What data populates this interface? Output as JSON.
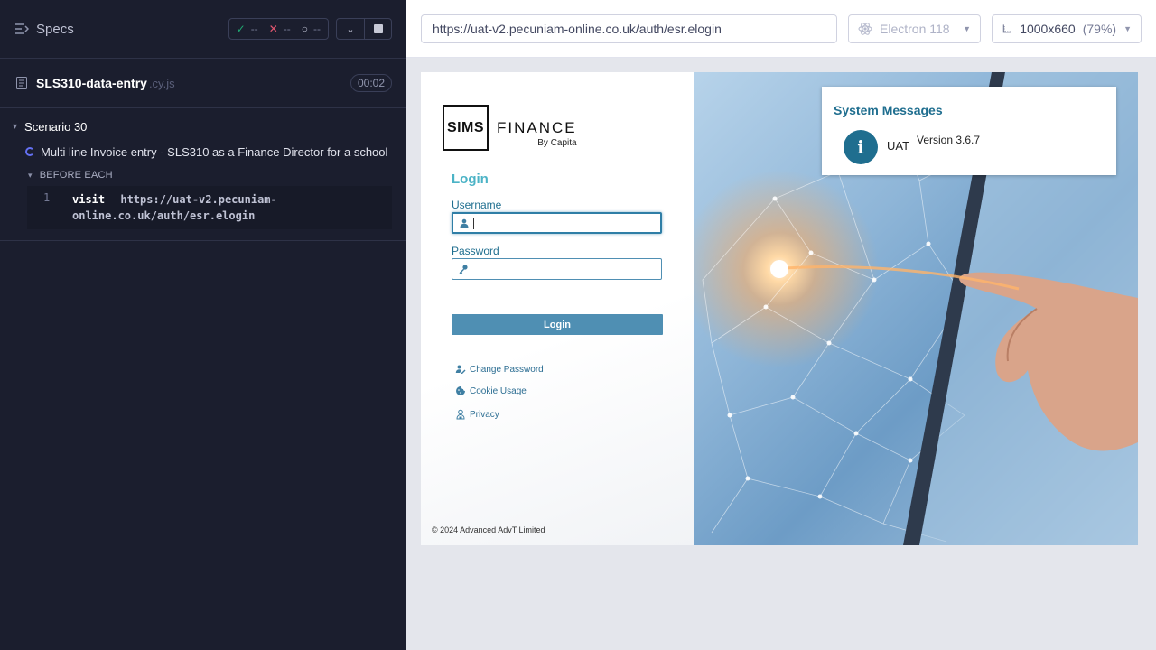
{
  "runner": {
    "specs_label": "Specs",
    "stats": {
      "passed": "--",
      "failed": "--",
      "pending": "--"
    },
    "spec": {
      "name": "SLS310-data-entry",
      "ext": ".cy.js",
      "duration": "00:02"
    },
    "suite": "Scenario 30",
    "test": "Multi line Invoice entry - SLS310 as a Finance Director for a school",
    "hook": "BEFORE EACH",
    "command": {
      "num": "1",
      "name": "visit",
      "message": "https://uat-v2.pecuniam-online.co.uk/auth/esr.elogin"
    }
  },
  "aut_header": {
    "url": "https://uat-v2.pecuniam-online.co.uk/auth/esr.elogin",
    "browser": "Electron 118",
    "viewport": "1000x660",
    "scale": "(79%)"
  },
  "page": {
    "logo": {
      "mark": "SIMS",
      "product": "FINANCE",
      "by": "By Capita"
    },
    "login_title": "Login",
    "username_label": "Username",
    "password_label": "Password",
    "login_button": "Login",
    "links": {
      "change_password": "Change Password",
      "cookie_usage": "Cookie Usage",
      "privacy": "Privacy"
    },
    "copyright": "© 2024 Advanced AdvT Limited",
    "system_messages": {
      "title": "System Messages",
      "env": "UAT",
      "version": "Version 3.6.7"
    }
  },
  "colors": {
    "accent": "#4f8fb3",
    "runner_bg": "#1b1e2e",
    "title_teal": "#4bb3c6"
  }
}
